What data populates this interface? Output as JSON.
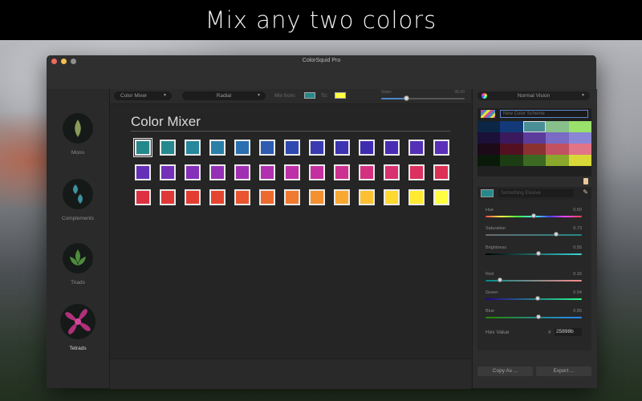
{
  "banner": {
    "text": "Mix any two colors"
  },
  "window": {
    "title": "ColorSquid Pro"
  },
  "sidebar": {
    "items": [
      {
        "label": "Mono",
        "active": false
      },
      {
        "label": "Complements",
        "active": false
      },
      {
        "label": "Triads",
        "active": false
      },
      {
        "label": "Tetrads",
        "active": true
      }
    ]
  },
  "toolbar": {
    "mode_select": "Color Mixer",
    "style_select": "Radial",
    "mix_from_label": "Mix from:",
    "to_label": "To:",
    "from_color": "#25898b",
    "to_color": "#ffff40",
    "steps_label": "Steps",
    "steps_value": "36.00",
    "steps_fraction": 0.3
  },
  "mixer": {
    "title": "Color Mixer",
    "swatches": [
      "#25898b",
      "#26898f",
      "#27879b",
      "#2a7fa8",
      "#2b6fb0",
      "#2e5cb0",
      "#3049b0",
      "#3a3bb0",
      "#3c33b0",
      "#3d2db1",
      "#4a2cb4",
      "#5430b6",
      "#5a30b8",
      "#6530b8",
      "#7530b8",
      "#8530b8",
      "#9430b5",
      "#a030b2",
      "#b030b0",
      "#be30a8",
      "#c430a0",
      "#cc3090",
      "#d43080",
      "#d83070",
      "#dc3060",
      "#dd3055",
      "#dd3040",
      "#e03838",
      "#e33c30",
      "#e54530",
      "#e85530",
      "#ec6a30",
      "#f07a30",
      "#f49030",
      "#f8a830",
      "#fcc030",
      "#ffd830",
      "#ffea30",
      "#ffff40"
    ]
  },
  "right_panel": {
    "vision_select": "Normal Vision",
    "palette_name_placeholder": "New Color Scheme",
    "palette_colors": [
      "#0c2646",
      "#123a78",
      "#4a8f96",
      "#88c08c",
      "#9ae06c",
      "#1a1038",
      "#3a1a5c",
      "#5c3c9a",
      "#7a6cc4",
      "#8a86d6",
      "#1c0a18",
      "#521020",
      "#8a3232",
      "#c25262",
      "#e27488",
      "#0a1a0a",
      "#1c3c14",
      "#3c6a22",
      "#8aa82c",
      "#d8d838"
    ],
    "field_placeholder": "Something Elusive",
    "field_color": "#25898b",
    "sliders": [
      {
        "label": "Hue",
        "value": "0.50",
        "fraction": 0.5
      },
      {
        "label": "Saturation",
        "value": "0.73",
        "fraction": 0.73
      },
      {
        "label": "Brightness",
        "value": "0.55",
        "fraction": 0.55
      },
      {
        "label": "Red",
        "value": "0.15",
        "fraction": 0.15
      },
      {
        "label": "Green",
        "value": "0.54",
        "fraction": 0.54
      },
      {
        "label": "Blue",
        "value": "0.55",
        "fraction": 0.55
      }
    ],
    "hex_label": "Hex Value",
    "hex_prefix": "#",
    "hex_value": "25898b",
    "copy_button": "Copy As ...",
    "export_button": "Export ..."
  },
  "colors": {
    "close": "#ed6a5e",
    "minimize": "#f5bf4f",
    "zoom": "#8f8f8f",
    "accent": "#5a86c8"
  }
}
